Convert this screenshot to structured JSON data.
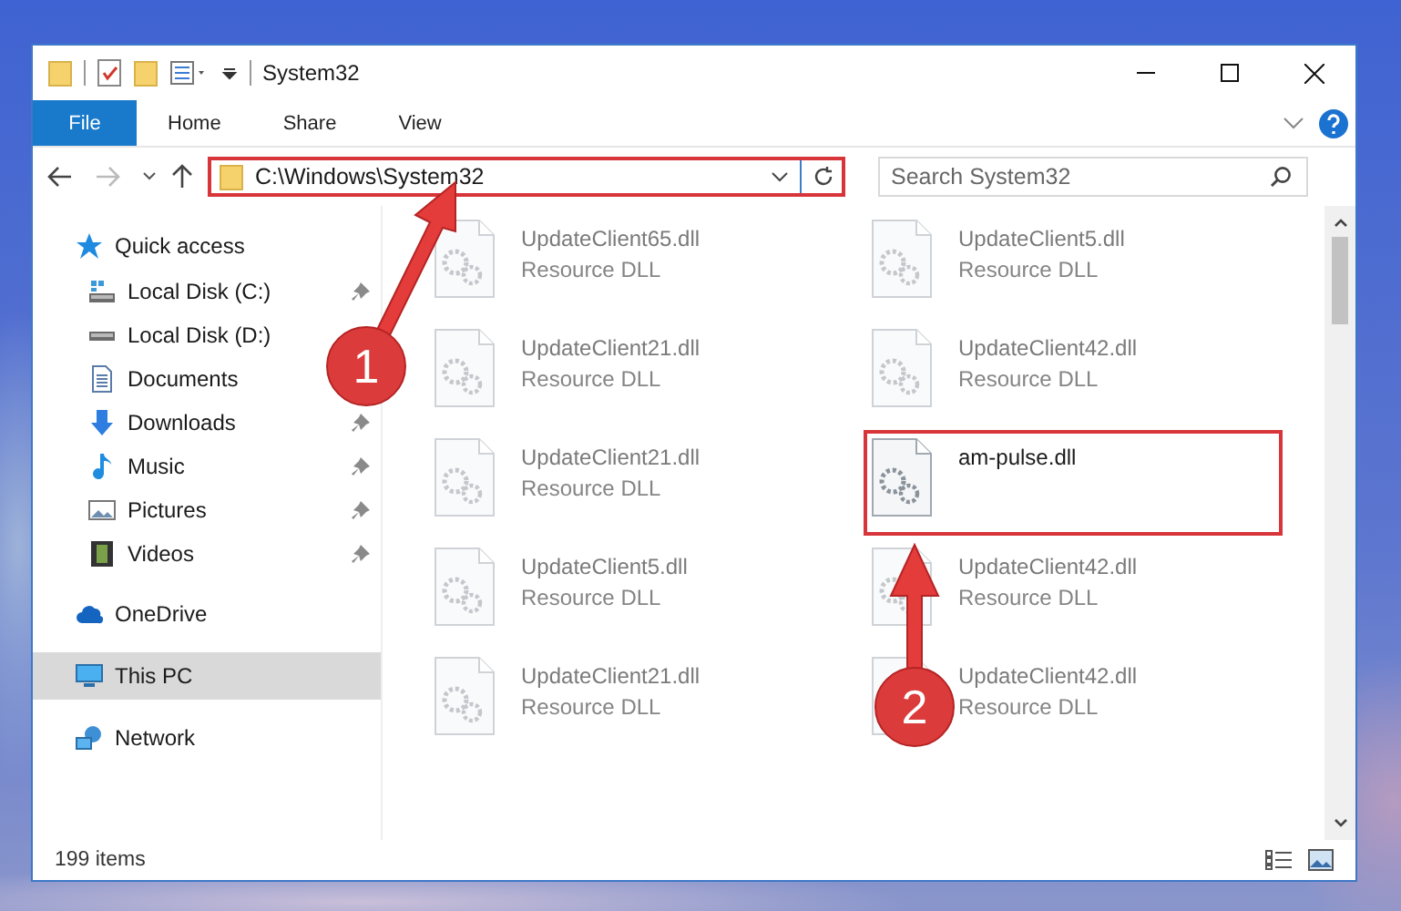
{
  "window": {
    "title": "System32"
  },
  "ribbon": {
    "tabs": [
      {
        "label": "File",
        "kind": "file"
      },
      {
        "label": "Home",
        "kind": "tab"
      },
      {
        "label": "Share",
        "kind": "tab"
      },
      {
        "label": "View",
        "kind": "tab"
      }
    ]
  },
  "address_bar": {
    "path": "C:\\Windows\\System32",
    "highlighted": true
  },
  "search": {
    "placeholder": "Search System32"
  },
  "navigation": [
    {
      "label": "Quick access",
      "selected": false,
      "children": [
        {
          "label": "Local Disk (C:)",
          "pinned": true,
          "selected": false
        },
        {
          "label": "Local Disk (D:)",
          "selected": false
        },
        {
          "label": "Documents",
          "selected": false
        },
        {
          "label": "Downloads",
          "pinned": true,
          "selected": false
        },
        {
          "label": "Music",
          "pinned": true,
          "selected": false
        },
        {
          "label": "Pictures",
          "pinned": true,
          "selected": false
        },
        {
          "label": "Videos",
          "pinned": true,
          "selected": false
        }
      ]
    },
    {
      "label": "OneDrive",
      "selected": false
    },
    {
      "label": "This PC",
      "selected": true
    },
    {
      "label": "Network",
      "selected": false
    }
  ],
  "files": [
    {
      "name": "UpdateClient65.dll",
      "type": "Resource DLL",
      "blurred": true,
      "highlighted": false
    },
    {
      "name": "UpdateClient5.dll",
      "type": "Resource DLL",
      "blurred": true,
      "highlighted": false
    },
    {
      "name": "UpdateClient21.dll",
      "type": "Resource DLL",
      "blurred": true,
      "highlighted": false
    },
    {
      "name": "UpdateClient42.dll",
      "type": "Resource DLL",
      "blurred": true,
      "highlighted": false
    },
    {
      "name": "UpdateClient21.dll",
      "type": "Resource DLL",
      "blurred": true,
      "highlighted": false
    },
    {
      "name": "am-pulse.dll",
      "blurred": false,
      "highlighted": true
    },
    {
      "name": "UpdateClient5.dll",
      "type": "Resource DLL",
      "blurred": true,
      "highlighted": false
    },
    {
      "name": "UpdateClient42.dll",
      "type": "Resource DLL",
      "blurred": true,
      "highlighted": false
    },
    {
      "name": "UpdateClient21.dll",
      "type": "Resource DLL",
      "blurred": true,
      "highlighted": false
    },
    {
      "name": "UpdateClient42.dll",
      "type": "Resource DLL",
      "blurred": true,
      "highlighted": false
    }
  ],
  "annotations": [
    {
      "label": "1"
    },
    {
      "label": "2"
    }
  ],
  "status_bar": {
    "item_count": "199 items"
  }
}
